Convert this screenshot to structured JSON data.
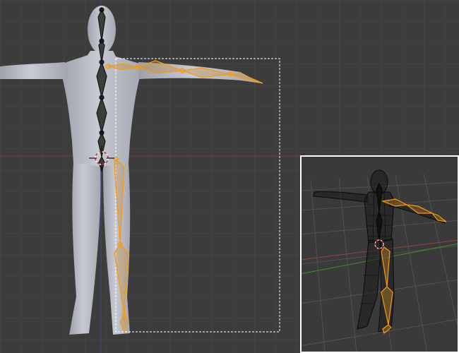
{
  "viewport": {
    "background": "#3c3c3c",
    "grid_color": "#474747",
    "x_axis_color": "#8a3a3a",
    "z_axis_color": "#3a4a8a",
    "mesh_color": "#b9bcc6",
    "bone_unselected_color": "#1a1a1a",
    "bone_selected_color": "#f39c1a",
    "selection_box_color": "#ffffff",
    "cursor_icon": "3d-cursor-icon"
  },
  "inset_view": {
    "border_color": "#ffffff",
    "wire_color": "#0a0a0a",
    "grid_color": "#555555",
    "x_axis_color": "#9a4040",
    "y_axis_color": "#4a8a3a",
    "bone_selected_color": "#f39c1a"
  }
}
